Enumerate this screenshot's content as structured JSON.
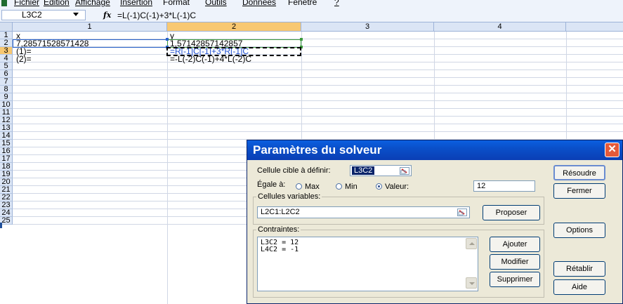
{
  "menu": [
    {
      "label": "Fichier",
      "u": 0
    },
    {
      "label": "Edition",
      "u": 0
    },
    {
      "label": "Affichage",
      "u": 0
    },
    {
      "label": "Insertion",
      "u": 0
    },
    {
      "label": "Format",
      "u": 5
    },
    {
      "label": "Outils",
      "u": 0
    },
    {
      "label": "Données",
      "u": 0
    },
    {
      "label": "Fenêtre",
      "u": 2
    },
    {
      "label": "?",
      "u": 0
    }
  ],
  "namebox": {
    "value": "L3C2"
  },
  "formula": {
    "fx": "fx",
    "text": "=L(-1)C(-1)+3*L(-1)C"
  },
  "columns": [
    "1",
    "2",
    "3",
    "4"
  ],
  "active_column": "2",
  "rows": [
    "1",
    "2",
    "3",
    "4",
    "5",
    "6",
    "7",
    "8",
    "9",
    "10",
    "11",
    "12",
    "13",
    "14",
    "15",
    "16",
    "17",
    "18",
    "19",
    "20",
    "21",
    "22",
    "23",
    "24",
    "25"
  ],
  "active_row": "3",
  "cells": {
    "r1c1": "x",
    "r1c2": "y",
    "r2c1": "7,28571528571428",
    "r2c2": "1,57142857142857",
    "r3c1": "(1)=",
    "r3c2": "=R[-1]C[-1]+3*R[-1]C",
    "r4c1": "(2)=",
    "r4c2": "=-L(-2)C(-1)+4*L(-2)C"
  },
  "dialog": {
    "title": "Paramètres du solveur",
    "target_label": "Cellule cible à définir:",
    "target_value": "L3C2",
    "equal_label": "Égale à:",
    "opt_max": "Max",
    "opt_min": "Min",
    "opt_value": "Valeur:",
    "selected_option": "Valeur",
    "value_input": "12",
    "variables_label": "Cellules variables:",
    "variables_value": "L2C1:L2C2",
    "constraints_label": "Contraintes:",
    "constraints": [
      "L3C2 = 12",
      "L4C2 = -1"
    ],
    "buttons": {
      "resolve": "Résoudre",
      "close": "Fermer",
      "propose": "Proposer",
      "options": "Options",
      "add": "Ajouter",
      "modify": "Modifier",
      "reset": "Rétablir",
      "delete": "Supprimer",
      "help": "Aide"
    }
  },
  "colors": {
    "titlebar": "#0a4fc9",
    "active_header": "#f8c872",
    "header": "#dbe5f5",
    "dialog_bg": "#ece9d8",
    "close_button": "#e45a3a"
  }
}
